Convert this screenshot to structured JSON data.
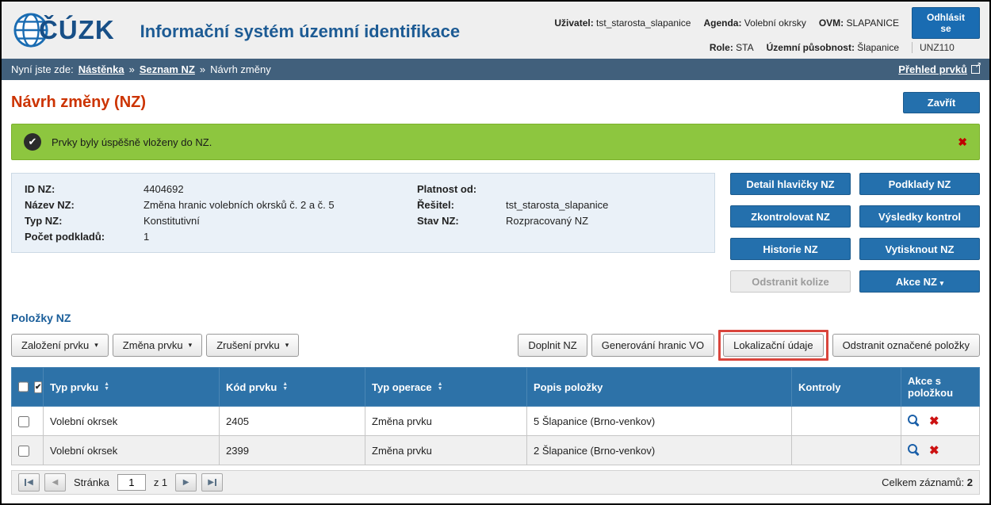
{
  "header": {
    "logo_text": "ČÚZK",
    "app_title": "Informační systém územní identifikace",
    "user_label": "Uživatel:",
    "user_value": "tst_starosta_slapanice",
    "agenda_label": "Agenda:",
    "agenda_value": "Volební okrsky",
    "ovm_label": "OVM:",
    "ovm_value": "SLAPANICE",
    "logout_label": "Odhlásit se",
    "role_label": "Role:",
    "role_value": "STA",
    "scope_label": "Územní působnost:",
    "scope_value": "Šlapanice",
    "code": "UNZ110"
  },
  "breadcrumb": {
    "prefix": "Nyní jste zde:",
    "separator": "»",
    "items": [
      {
        "label": "Nástěnka"
      },
      {
        "label": "Seznam NZ"
      },
      {
        "label": "Návrh změny"
      }
    ],
    "right_link": "Přehled prvků"
  },
  "page": {
    "title": "Návrh změny (NZ)",
    "close_button": "Zavřít"
  },
  "message": {
    "text": "Prvky byly úspěšně vloženy do NZ."
  },
  "info_panel": {
    "fields": {
      "id_label": "ID NZ:",
      "id_value": "4404692",
      "platnost_label": "Platnost od:",
      "platnost_value": "",
      "nazev_label": "Název NZ:",
      "nazev_value": "Změna hranic volebních okrsků č. 2 a č. 5",
      "resitel_label": "Řešitel:",
      "resitel_value": "tst_starosta_slapanice",
      "typ_label": "Typ NZ:",
      "typ_value": "Konstitutivní",
      "stav_label": "Stav NZ:",
      "stav_value": "Rozpracovaný NZ",
      "podklady_label": "Počet podkladů:",
      "podklady_value": "1"
    }
  },
  "actions": {
    "buttons": [
      {
        "label": "Detail hlavičky NZ"
      },
      {
        "label": "Podklady NZ"
      },
      {
        "label": "Zkontrolovat NZ"
      },
      {
        "label": "Výsledky kontrol"
      },
      {
        "label": "Historie NZ"
      },
      {
        "label": "Vytisknout NZ"
      },
      {
        "label": "Odstranit kolize"
      },
      {
        "label": "Akce NZ"
      }
    ]
  },
  "items_section": {
    "title": "Položky NZ",
    "toolbar_left": [
      {
        "label": "Založení prvku"
      },
      {
        "label": "Změna prvku"
      },
      {
        "label": "Zrušení prvku"
      }
    ],
    "toolbar_right": [
      {
        "label": "Doplnit NZ"
      },
      {
        "label": "Generování hranic VO"
      },
      {
        "label": "Lokalizační údaje"
      },
      {
        "label": "Odstranit označené položky"
      }
    ]
  },
  "table": {
    "columns": {
      "typ_prvku": "Typ prvku",
      "kod_prvku": "Kód prvku",
      "typ_operace": "Typ operace",
      "popis": "Popis položky",
      "kontroly": "Kontroly",
      "akce": "Akce s položkou"
    },
    "rows": [
      {
        "typ_prvku": "Volební okrsek",
        "kod_prvku": "2405",
        "typ_operace": "Změna prvku",
        "popis": "5 Šlapanice (Brno-venkov)",
        "kontroly": ""
      },
      {
        "typ_prvku": "Volební okrsek",
        "kod_prvku": "2399",
        "typ_operace": "Změna prvku",
        "popis": "2 Šlapanice (Brno-venkov)",
        "kontroly": ""
      }
    ]
  },
  "pagination": {
    "page_label": "Stránka",
    "page_value": "1",
    "of_label": "z 1",
    "total_label": "Celkem záznamů:",
    "total_value": "2"
  },
  "icons": {
    "caret_down": "▾",
    "sort_up": "▲",
    "sort_down": "▼",
    "close_x": "✖",
    "check": "✔",
    "external": "↗",
    "arrow_left": "◀",
    "arrow_right": "▶"
  }
}
